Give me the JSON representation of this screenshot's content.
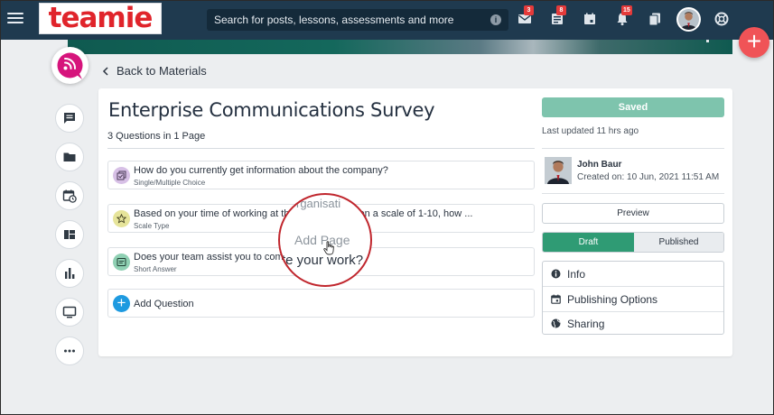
{
  "header": {
    "logo_text": "teamie",
    "search_placeholder": "Search for posts, lessons, assessments and more",
    "badges": {
      "messages": "3",
      "posts": "8",
      "notifications": "15"
    }
  },
  "nav": {
    "back_label": "Back to Materials"
  },
  "survey": {
    "title": "Enterprise Communications Survey",
    "count": "3 Questions in 1 Page",
    "questions": [
      {
        "title": "How do you currently get information about the company?",
        "type": "Single/Multiple Choice",
        "icon": "multiple-choice-icon",
        "color": "#d7c0e6"
      },
      {
        "title": "Based on your time of working at this organisation, on a scale of 1-10, how ...",
        "type": "Scale Type",
        "icon": "star-icon",
        "color": "#e6e49a"
      },
      {
        "title": "Does your team assist you to complete your work?",
        "type": "Short Answer",
        "icon": "short-answer-icon",
        "color": "#8fd0b3"
      }
    ],
    "add_question_label": "Add Question"
  },
  "lens": {
    "top_text": "rganisati",
    "middle_text": "Add Page",
    "bottom_text": "te your work?"
  },
  "sidebar": {
    "saved_label": "Saved",
    "last_updated": "Last updated 11 hrs ago",
    "author_name": "John Baur",
    "created": "Created on: 10 Jun, 2021 11:51 AM",
    "preview_label": "Preview",
    "draft_label": "Draft",
    "published_label": "Published",
    "menu": [
      {
        "label": "Info",
        "icon": "info-icon"
      },
      {
        "label": "Publishing Options",
        "icon": "calendar-icon"
      },
      {
        "label": "Sharing",
        "icon": "globe-icon"
      }
    ]
  },
  "colors": {
    "topbar": "#1f3a4f",
    "accent_green": "#2f9b74",
    "saved_green": "#7ec4ad",
    "fab_red": "#f05357",
    "add_blue": "#1e9ae0",
    "brand_red": "#e0242b",
    "app_logo_magenta": "#d6147c"
  }
}
